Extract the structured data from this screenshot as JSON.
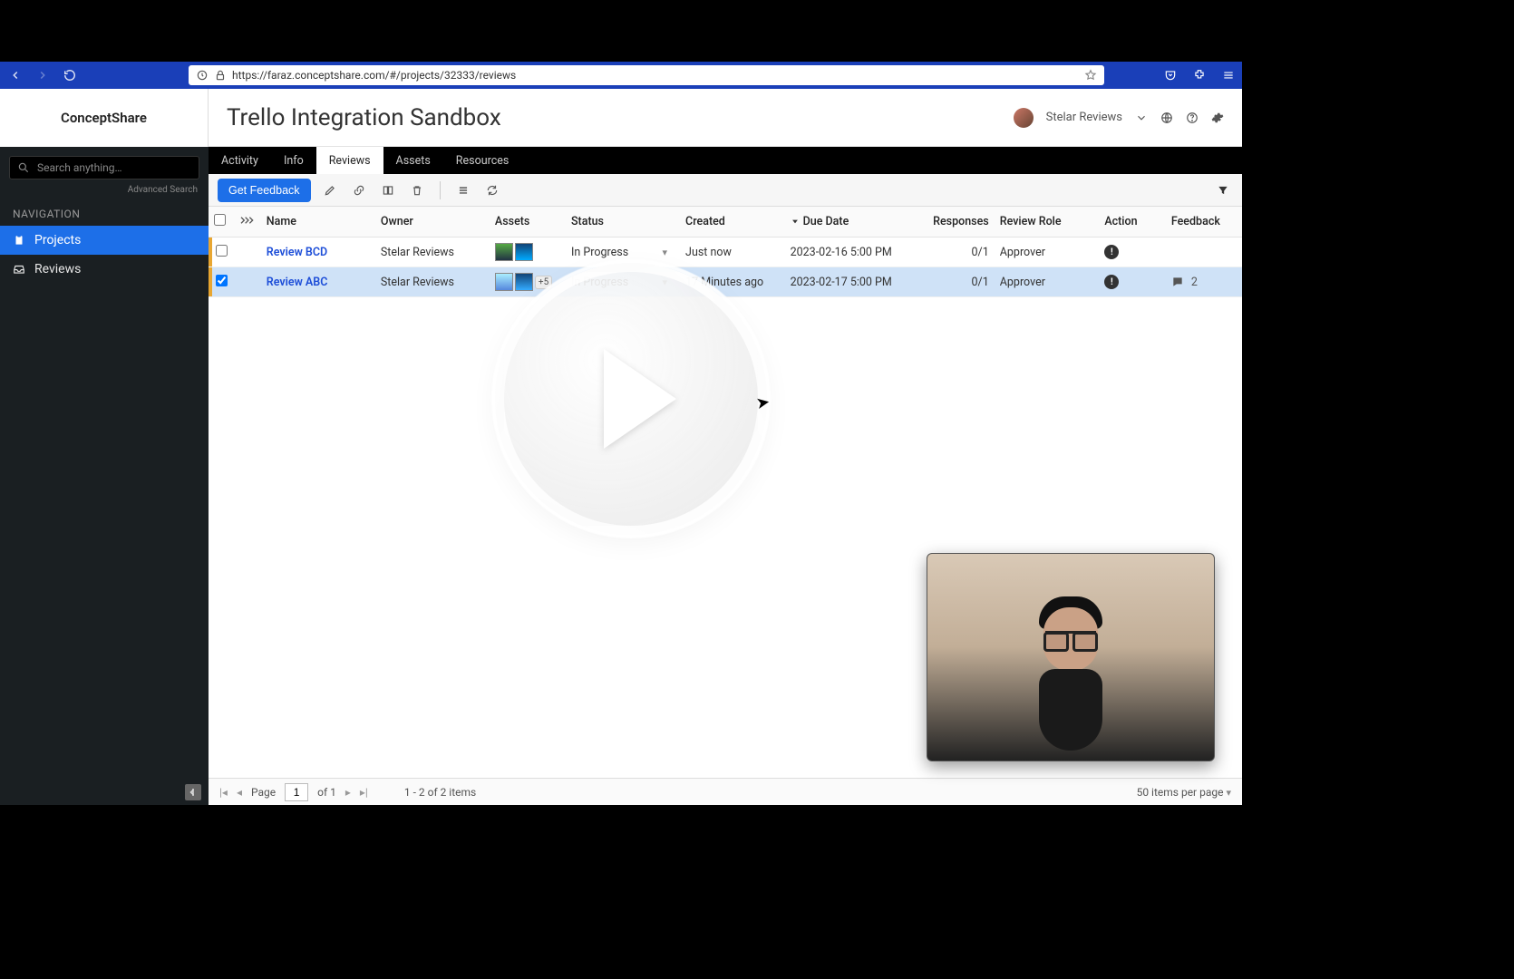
{
  "browser": {
    "url": "https://faraz.conceptshare.com/#/projects/32333/reviews"
  },
  "brand": "ConceptShare",
  "sidebar": {
    "searchPlaceholder": "Search anything…",
    "advanced": "Advanced Search",
    "heading": "NAVIGATION",
    "items": [
      {
        "label": "Projects",
        "active": true
      },
      {
        "label": "Reviews",
        "active": false
      }
    ]
  },
  "header": {
    "title": "Trello Integration Sandbox",
    "user": "Stelar Reviews"
  },
  "tabs": [
    {
      "label": "Activity",
      "active": false
    },
    {
      "label": "Info",
      "active": false
    },
    {
      "label": "Reviews",
      "active": true
    },
    {
      "label": "Assets",
      "active": false
    },
    {
      "label": "Resources",
      "active": false
    }
  ],
  "toolbar": {
    "primary": "Get Feedback"
  },
  "columns": {
    "name": "Name",
    "owner": "Owner",
    "assets": "Assets",
    "status": "Status",
    "created": "Created",
    "due": "Due Date",
    "responses": "Responses",
    "role": "Review Role",
    "action": "Action",
    "feedback": "Feedback"
  },
  "rows": [
    {
      "selected": false,
      "name": "Review BCD",
      "owner": "Stelar Reviews",
      "extraAssets": "",
      "status": "In Progress",
      "created": "Just now",
      "due": "2023-02-16 5:00 PM",
      "responses": "0/1",
      "role": "Approver",
      "feedbackCount": ""
    },
    {
      "selected": true,
      "name": "Review ABC",
      "owner": "Stelar Reviews",
      "extraAssets": "+5",
      "status": "In Progress",
      "created": "17 Minutes ago",
      "due": "2023-02-17 5:00 PM",
      "responses": "0/1",
      "role": "Approver",
      "feedbackCount": "2"
    }
  ],
  "footer": {
    "pageLabel": "Page",
    "pageValue": "1",
    "ofLabel": "of 1",
    "range": "1 - 2 of 2 items",
    "perPage": "50 items per page"
  }
}
